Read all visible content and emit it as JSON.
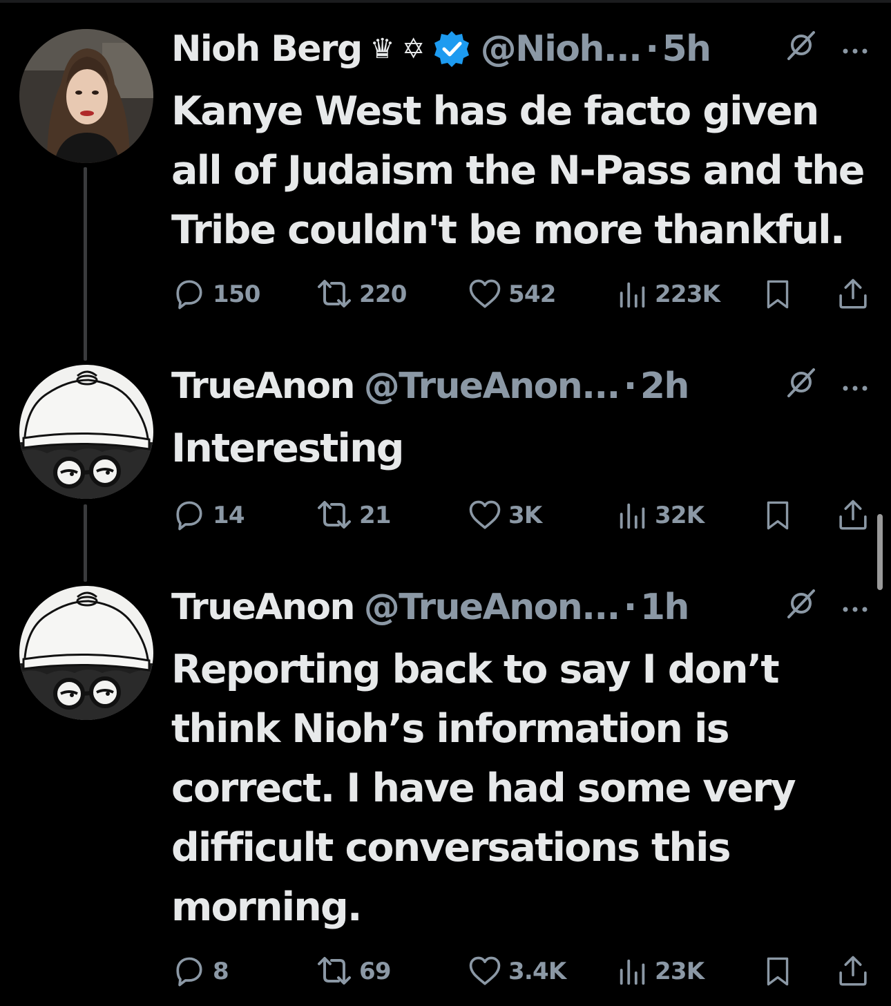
{
  "colors": {
    "background": "#000000",
    "text_primary": "#e7e9ea",
    "text_secondary": "#8b98a5",
    "verified_blue": "#1d9bf0",
    "thread_line": "#3a3b3d"
  },
  "tweets": [
    {
      "author": {
        "name": "Nioh Berg",
        "badges": [
          "crown-emoji",
          "star-of-david-emoji",
          "verified-badge-icon"
        ],
        "handle": "@Nioh...",
        "avatar": "profile-photo"
      },
      "time": "5h",
      "body": [
        "Kanye West has de facto given",
        "all of Judaism the N-Pass and the",
        "Tribe couldn't be more thankful."
      ],
      "stats": {
        "replies": "150",
        "reposts": "220",
        "likes": "542",
        "views": "223K"
      }
    },
    {
      "author": {
        "name": "TrueAnon",
        "handle": "@TrueAnon...",
        "avatar": "cartoon-hat-glasses"
      },
      "time": "2h",
      "body": [
        "Interesting"
      ],
      "stats": {
        "replies": "14",
        "reposts": "21",
        "likes": "3K",
        "views": "32K"
      }
    },
    {
      "author": {
        "name": "TrueAnon",
        "handle": "@TrueAnon...",
        "avatar": "cartoon-hat-glasses"
      },
      "time": "1h",
      "body": [
        "Reporting back to say I don’t",
        "think Nioh’s information is",
        "correct. I have had some very",
        "difficult conversations this",
        "morning."
      ],
      "stats": {
        "replies": "8",
        "reposts": "69",
        "likes": "3.4K",
        "views": "23K"
      }
    }
  ],
  "glyphs": {
    "crown": "♛",
    "star_of_david": "✡",
    "dot": "·"
  }
}
